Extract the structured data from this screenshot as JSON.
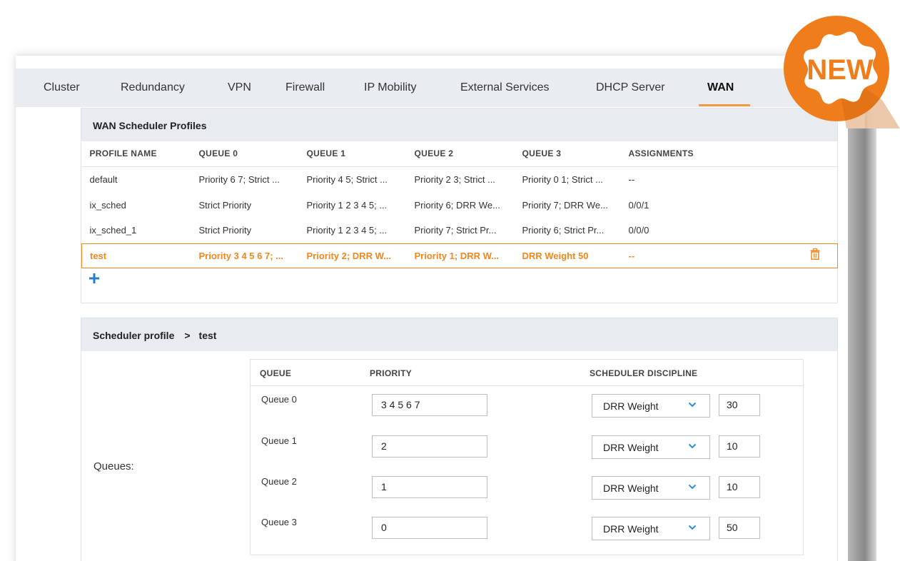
{
  "badge": {
    "text": "NEW"
  },
  "tabs": [
    {
      "label": "Cluster"
    },
    {
      "label": "Redundancy"
    },
    {
      "label": "VPN"
    },
    {
      "label": "Firewall"
    },
    {
      "label": "IP Mobility"
    },
    {
      "label": "External Services"
    },
    {
      "label": "DHCP Server"
    },
    {
      "label": "WAN"
    }
  ],
  "active_tab": "WAN",
  "profiles": {
    "title": "WAN Scheduler Profiles",
    "columns": [
      "PROFILE NAME",
      "QUEUE 0",
      "QUEUE 1",
      "QUEUE 2",
      "QUEUE 3",
      "ASSIGNMENTS"
    ],
    "rows": [
      [
        "default",
        "Priority 6 7; Strict ...",
        "Priority 4 5; Strict ...",
        "Priority 2 3; Strict ...",
        "Priority 0 1; Strict ...",
        "--"
      ],
      [
        "ix_sched",
        "Strict Priority",
        "Priority 1 2 3 4 5; ...",
        "Priority 6; DRR We...",
        "Priority 7; DRR We...",
        "0/0/1"
      ],
      [
        "ix_sched_1",
        "Strict Priority",
        "Priority 1 2 3 4 5; ...",
        "Priority 7; Strict Pr...",
        "Priority 6; Strict Pr...",
        "0/0/0"
      ],
      [
        "test",
        "Priority 3 4 5 6 7; ...",
        "Priority 2; DRR W...",
        "Priority 1; DRR W...",
        "DRR Weight 50",
        "--"
      ]
    ],
    "selected_row": 3
  },
  "detail": {
    "title": "Scheduler profile",
    "separator": ">",
    "profile_name": "test",
    "queues_label": "Queues:",
    "columns": {
      "queue": "QUEUE",
      "priority": "PRIORITY",
      "discipline": "SCHEDULER DISCIPLINE"
    },
    "queues": [
      {
        "name": "Queue 0",
        "priority": "3 4 5 6 7",
        "discipline": "DRR Weight",
        "weight": "30"
      },
      {
        "name": "Queue 1",
        "priority": "2",
        "discipline": "DRR Weight",
        "weight": "10"
      },
      {
        "name": "Queue 2",
        "priority": "1",
        "discipline": "DRR Weight",
        "weight": "10"
      },
      {
        "name": "Queue 3",
        "priority": "0",
        "discipline": "DRR Weight",
        "weight": "50"
      }
    ]
  },
  "colors": {
    "accent": "#f0871f",
    "header_bg": "#e8ecf0",
    "add_icon": "#2a7fc4",
    "chevron": "#2a8fd8"
  }
}
